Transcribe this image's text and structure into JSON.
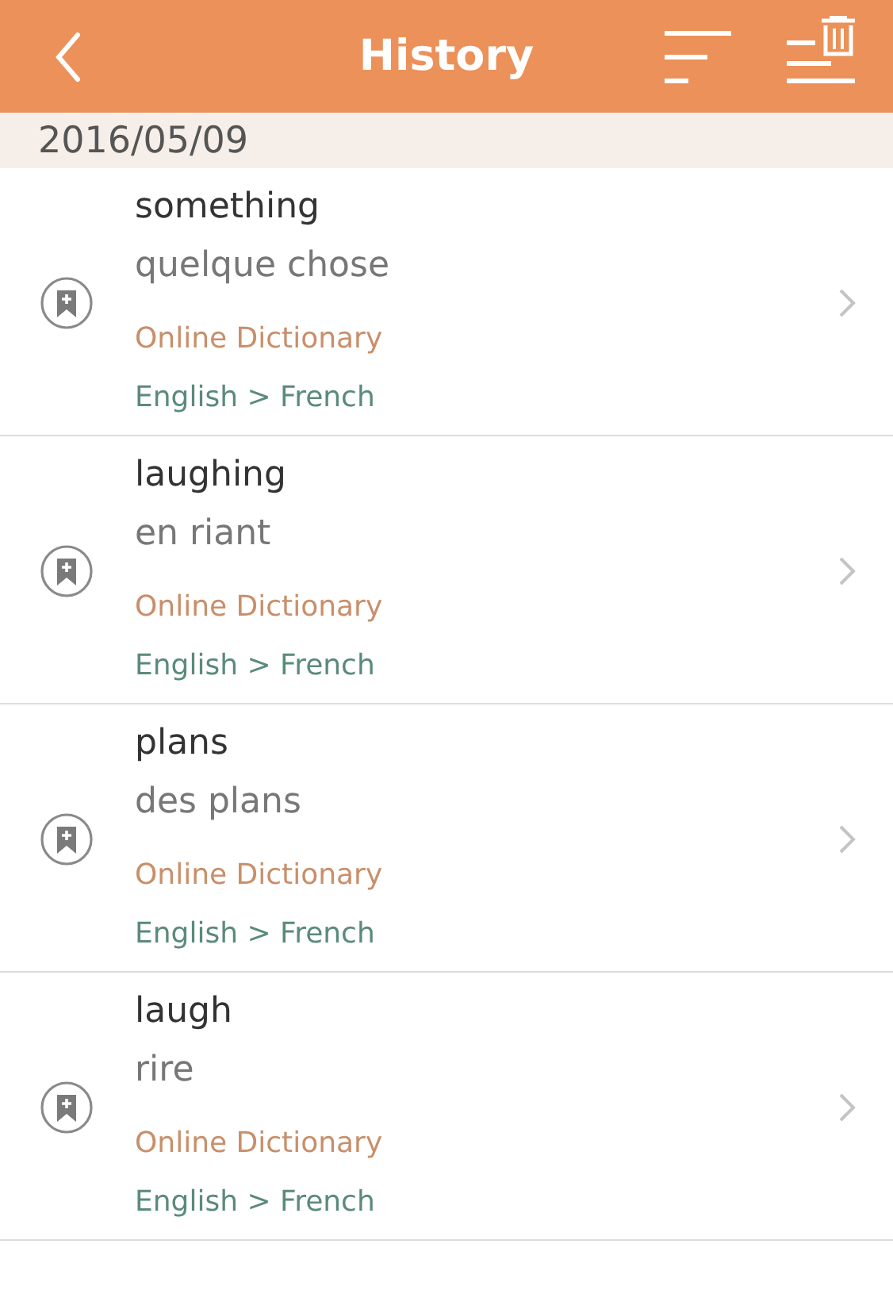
{
  "header": {
    "title": "History"
  },
  "date": "2016/05/09",
  "entries": [
    {
      "word": "something",
      "translation": "quelque chose",
      "source": "Online Dictionary",
      "languages": "English > French"
    },
    {
      "word": "laughing",
      "translation": "en riant",
      "source": "Online Dictionary",
      "languages": "English > French"
    },
    {
      "word": "plans",
      "translation": "des plans",
      "source": "Online Dictionary",
      "languages": "English > French"
    },
    {
      "word": "laugh",
      "translation": "rire",
      "source": "Online Dictionary",
      "languages": "English > French"
    }
  ]
}
